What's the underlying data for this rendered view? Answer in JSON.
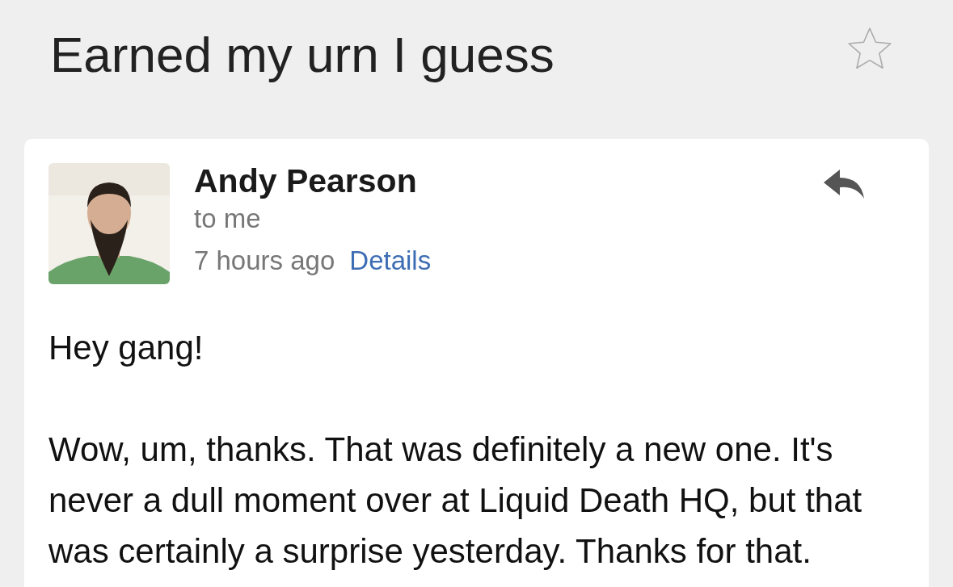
{
  "subject": "Earned my urn I guess",
  "starred": false,
  "message": {
    "sender": "Andy Pearson",
    "recipient": "to me",
    "time": "7 hours ago",
    "details_link": "Details",
    "body": [
      "Hey gang!",
      "Wow, um, thanks. That was definitely a new one. It's never a dull moment over at Liquid Death HQ, but that was certainly a surprise yesterday. Thanks for that."
    ]
  }
}
